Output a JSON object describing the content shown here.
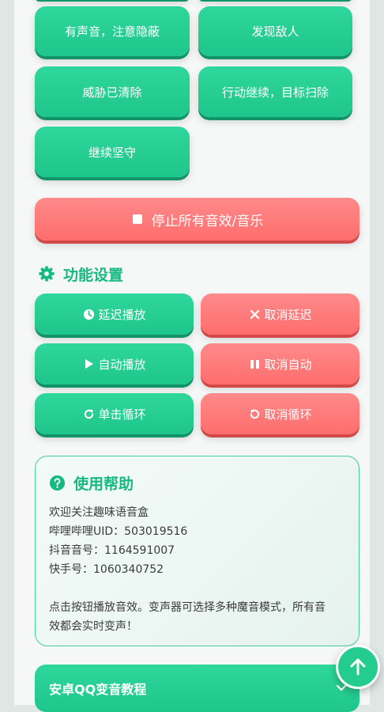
{
  "sound_buttons": [
    {
      "label": "有声音，注意隐蔽"
    },
    {
      "label": "发现敌人"
    },
    {
      "label": "威胁已清除"
    },
    {
      "label": "行动继续，目标扫除"
    },
    {
      "label": "继续坚守"
    }
  ],
  "stop_button": {
    "label": "停止所有音效/音乐",
    "icon": "stop-icon"
  },
  "settings": {
    "title": "功能设置",
    "icon": "gear-icon",
    "buttons": [
      {
        "label": "延迟播放",
        "icon": "clock-icon",
        "color": "#25cc8f"
      },
      {
        "label": "取消延迟",
        "icon": "close-icon",
        "color": "#ff7575"
      },
      {
        "label": "自动播放",
        "icon": "play-icon",
        "color": "#25cc8f"
      },
      {
        "label": "取消自动",
        "icon": "pause-icon",
        "color": "#ff7575"
      },
      {
        "label": "单击循环",
        "icon": "redo-icon",
        "color": "#25cc8f"
      },
      {
        "label": "取消循环",
        "icon": "undo-icon",
        "color": "#ff7575"
      }
    ]
  },
  "help": {
    "title": "使用帮助",
    "icon": "question-circle-icon",
    "lines": [
      "欢迎关注趣味语音盒",
      "哔哩哔哩UID：503019516",
      "抖音音号：1164591007",
      "快手号：1060340752",
      "",
      "点击按钮播放音效。变声器可选择多种魔音模式，所有音",
      "效都会实时变声！"
    ]
  },
  "accordion": {
    "title": "安卓QQ变音教程",
    "icon": "chevron-down-icon"
  },
  "fab": {
    "icon": "arrow-up-icon"
  },
  "colors": {
    "accent": "#25cc8f",
    "danger": "#ff7575"
  }
}
